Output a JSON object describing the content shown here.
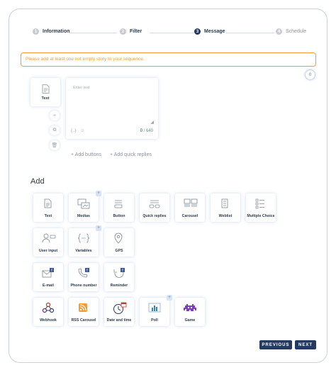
{
  "stepper": {
    "steps": [
      {
        "num": "1",
        "label": "Information",
        "state": "done"
      },
      {
        "num": "2",
        "label": "Filter",
        "state": "done"
      },
      {
        "num": "3",
        "label": "Message",
        "state": "active"
      },
      {
        "num": "4",
        "label": "Schedule",
        "state": "pending"
      }
    ]
  },
  "alert": {
    "text": "Please add at least one not empty story to your sequence."
  },
  "counter": "0",
  "story": {
    "card_label": "Text",
    "editor_placeholder": "Enter text",
    "char_count_current": "0",
    "char_count_max": "/ 640",
    "tool_variables": "{..}",
    "add_buttons": "Add buttons",
    "add_quick_replies": "Add quick replies"
  },
  "add_section": {
    "title": "Add",
    "tiles": [
      {
        "label": "Text",
        "icon": "document-icon",
        "plus": false
      },
      {
        "label": "Medias",
        "icon": "media-icon",
        "plus": true
      },
      {
        "label": "Button",
        "icon": "button-icon",
        "plus": false
      },
      {
        "label": "Quick replies",
        "icon": "quick-replies-icon",
        "plus": false
      },
      {
        "label": "Carousel",
        "icon": "carousel-icon",
        "plus": false
      },
      {
        "label": "Weblist",
        "icon": "weblist-icon",
        "plus": false
      },
      {
        "label": "Multiple Choice",
        "icon": "multiple-choice-icon",
        "plus": false
      },
      {
        "label": "User input",
        "icon": "user-input-icon",
        "plus": false
      },
      {
        "label": "Variables",
        "icon": "variables-icon",
        "plus": true
      },
      {
        "label": "GPS",
        "icon": "location-pin-icon",
        "plus": false
      },
      {
        "label": "E-mail",
        "icon": "email-icon",
        "plus": false
      },
      {
        "label": "Phone number",
        "icon": "phone-icon",
        "plus": false
      },
      {
        "label": "Reminder",
        "icon": "reminder-icon",
        "plus": false
      },
      {
        "label": "Webhook",
        "icon": "webhook-icon",
        "plus": false
      },
      {
        "label": "RSS Carousel",
        "icon": "rss-icon",
        "plus": false
      },
      {
        "label": "Date and time",
        "icon": "date-time-icon",
        "plus": false
      },
      {
        "label": "Poll",
        "icon": "poll-icon",
        "plus": true
      },
      {
        "label": "Game",
        "icon": "game-icon",
        "plus": false
      }
    ]
  },
  "footer": {
    "previous": "PREVIOUS",
    "next": "NEXT"
  },
  "colors": {
    "accent": "#243a5e",
    "warning": "#f39c34",
    "tile_shadow": "#6e96d2"
  }
}
